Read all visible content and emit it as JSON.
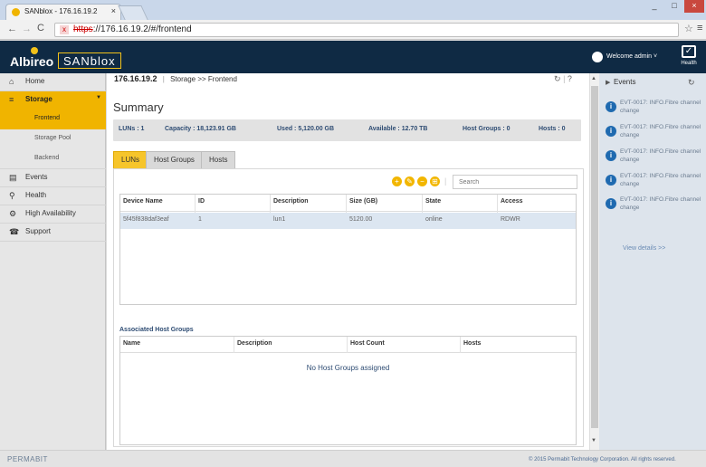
{
  "browser": {
    "tab_title": "SANblox - 176.16.19.2",
    "tab_close": "×",
    "url_scheme": "https",
    "url_rest": "://176.16.19.2/#/frontend",
    "window_buttons": [
      "_",
      "–",
      "□",
      "×"
    ]
  },
  "header": {
    "logo_left": "Albireo",
    "logo_right": "SANblox",
    "welcome": "Welcome admin ˅",
    "health_label": "Health"
  },
  "sidebar": {
    "items": [
      {
        "label": "Home",
        "icon": "home-icon"
      },
      {
        "label": "Storage",
        "icon": "storage-icon"
      },
      {
        "label": "Events",
        "icon": "events-icon"
      },
      {
        "label": "Health",
        "icon": "health-icon"
      },
      {
        "label": "High Availability",
        "icon": "ha-icon"
      },
      {
        "label": "Support",
        "icon": "phone-icon"
      }
    ],
    "storage_sub": [
      "Frontend",
      "Storage Pool",
      "Backend"
    ]
  },
  "breadcrumb": {
    "host": "176.16.19.2",
    "sep": "|",
    "path": "Storage >> Frontend"
  },
  "main": {
    "title": "Summary",
    "summary": {
      "luns": "LUNs : 1",
      "capacity": "Capacity : 18,123.91 GB",
      "used": "Used : 5,120.00 GB",
      "available": "Available : 12.70 TB",
      "host_groups": "Host Groups : 0",
      "hosts": "Hosts : 0"
    },
    "tabs": [
      "LUNs",
      "Host Groups",
      "Hosts"
    ],
    "search_placeholder": "Search",
    "lun_columns": [
      "Device Name",
      "ID",
      "Description",
      "Size (GB)",
      "State",
      "Access"
    ],
    "lun_row": [
      "5f45f838daf3eaf",
      "1",
      "lun1",
      "5120.00",
      "online",
      "RDWR"
    ],
    "assoc_title": "Associated Host Groups",
    "hg_columns": [
      "Name",
      "Description",
      "Host Count",
      "Hosts"
    ],
    "no_hg": "No Host Groups assigned"
  },
  "events": {
    "title": "Events",
    "items": [
      "EVT-0017: INFO.Fibre channel change",
      "EVT-0017: INFO.Fibre channel change",
      "EVT-0017: INFO.Fibre channel change",
      "EVT-0017: INFO.Fibre channel change",
      "EVT-0017: INFO.Fibre channel change"
    ],
    "view_details": "View details >>"
  },
  "footer": {
    "brand": "PERMABIT",
    "copyright": "© 2015 Permabit Technology Corporation. All rights reserved."
  },
  "colors": {
    "header_bg": "#0f2a44",
    "accent": "#f6c52b",
    "active_sidebar": "#f0b400",
    "summary_text": "#2e4c73"
  }
}
